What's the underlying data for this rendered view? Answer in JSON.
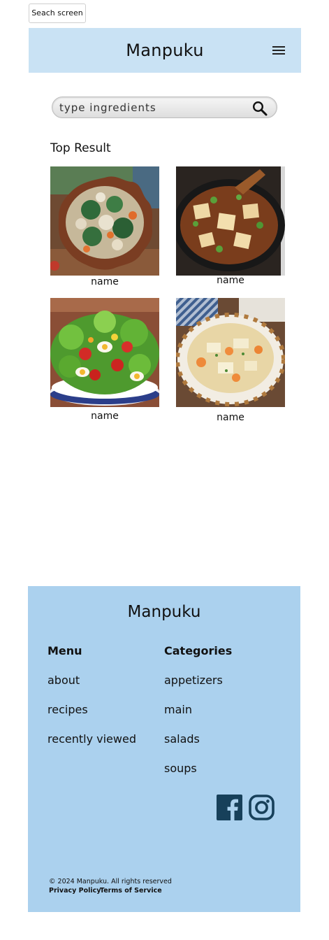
{
  "screen_tag": "Seach screen",
  "header": {
    "title": "Manpuku",
    "menu_icon": "hamburger-menu-icon"
  },
  "search": {
    "placeholder": "type ingredients",
    "value": "",
    "icon": "search-icon"
  },
  "results": {
    "title": "Top Result",
    "items": [
      {
        "name": "name",
        "photo": "spinach-tofu-salad"
      },
      {
        "name": "name",
        "photo": "mapo-tofu"
      },
      {
        "name": "name",
        "photo": "green-salad-with-egg"
      },
      {
        "name": "name",
        "photo": "vegetable-soup"
      }
    ]
  },
  "footer": {
    "brand": "Manpuku",
    "menu": {
      "heading": "Menu",
      "links": [
        "about",
        "recipes",
        "recently viewed"
      ]
    },
    "categories": {
      "heading": "Categories",
      "links": [
        "appetizers",
        "main",
        "salads",
        "soups"
      ]
    },
    "social": [
      "facebook-icon",
      "instagram-icon"
    ],
    "social_color": "#17405a",
    "copyright": "© 2024 Manpuku. All rights reserved",
    "legal": [
      "Privacy Policy",
      "Terms of Service"
    ]
  },
  "colors": {
    "header_bg": "#c9e2f4",
    "footer_bg": "#abd1ee"
  }
}
